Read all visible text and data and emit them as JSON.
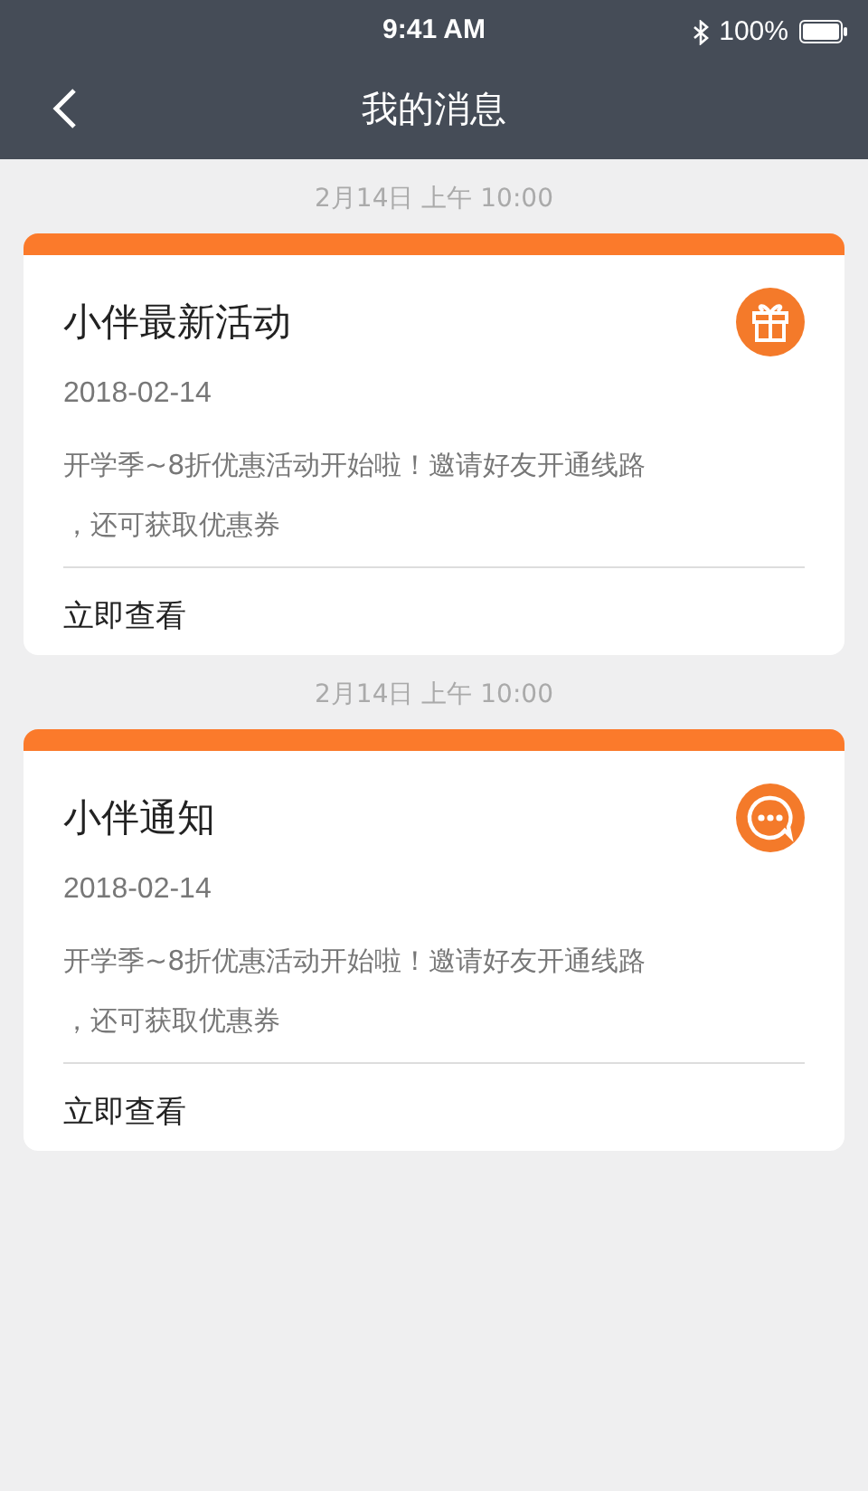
{
  "status_bar": {
    "time": "9:41 AM",
    "battery": "100%"
  },
  "nav": {
    "title": "我的消息"
  },
  "messages": [
    {
      "timestamp": "2月14日 上午 10:00",
      "title": "小伴最新活动",
      "date": "2018-02-14",
      "body_lines": [
        "开学季~8折优惠活动开始啦！邀请好友开通线路",
        "，还可获取优惠券"
      ],
      "action": "立即查看",
      "kind": "gift"
    },
    {
      "timestamp": "2月14日 上午 10:00",
      "title": "小伴通知",
      "date": "2018-02-14",
      "body_lines": [
        "开学季~8折优惠活动开始啦！邀请好友开通线路",
        "，还可获取优惠券"
      ],
      "action": "立即查看",
      "kind": "chat"
    }
  ]
}
